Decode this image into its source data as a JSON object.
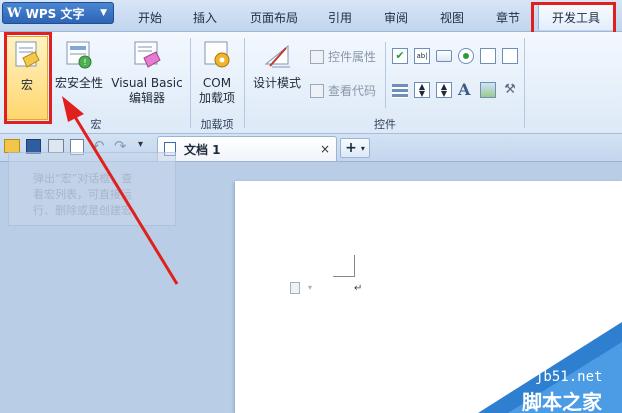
{
  "app": {
    "name": "WPS 文字",
    "logo": "W"
  },
  "menu_tabs": [
    "开始",
    "插入",
    "页面布局",
    "引用",
    "审阅",
    "视图",
    "章节",
    "开发工具"
  ],
  "ribbon": {
    "macro_group": {
      "label": "宏",
      "macro_button": "宏",
      "macro_security_button": "宏安全性",
      "vb_editor_button_line1": "Visual Basic",
      "vb_editor_button_line2": "编辑器"
    },
    "addins_group": {
      "label": "加载项",
      "com_addins_line1": "COM",
      "com_addins_line2": "加载项"
    },
    "controls_group": {
      "label": "控件",
      "design_mode_button": "设计模式",
      "control_properties": "控件属性",
      "view_code": "查看代码"
    }
  },
  "document_tab": {
    "title": "文档 1",
    "close": "×",
    "new_tab": "+"
  },
  "tooltip": {
    "line1": "弹出“宏”对话框，查",
    "line2": "看宏列表，可直接运",
    "line3": "行、删除或是创建宏。"
  },
  "watermark": {
    "site": "jb51.net",
    "name": "脚本之家"
  },
  "colors": {
    "highlight": "#e0201c",
    "ribbon_bg": "#e9f1fb",
    "app_button": "#2e64b4"
  }
}
